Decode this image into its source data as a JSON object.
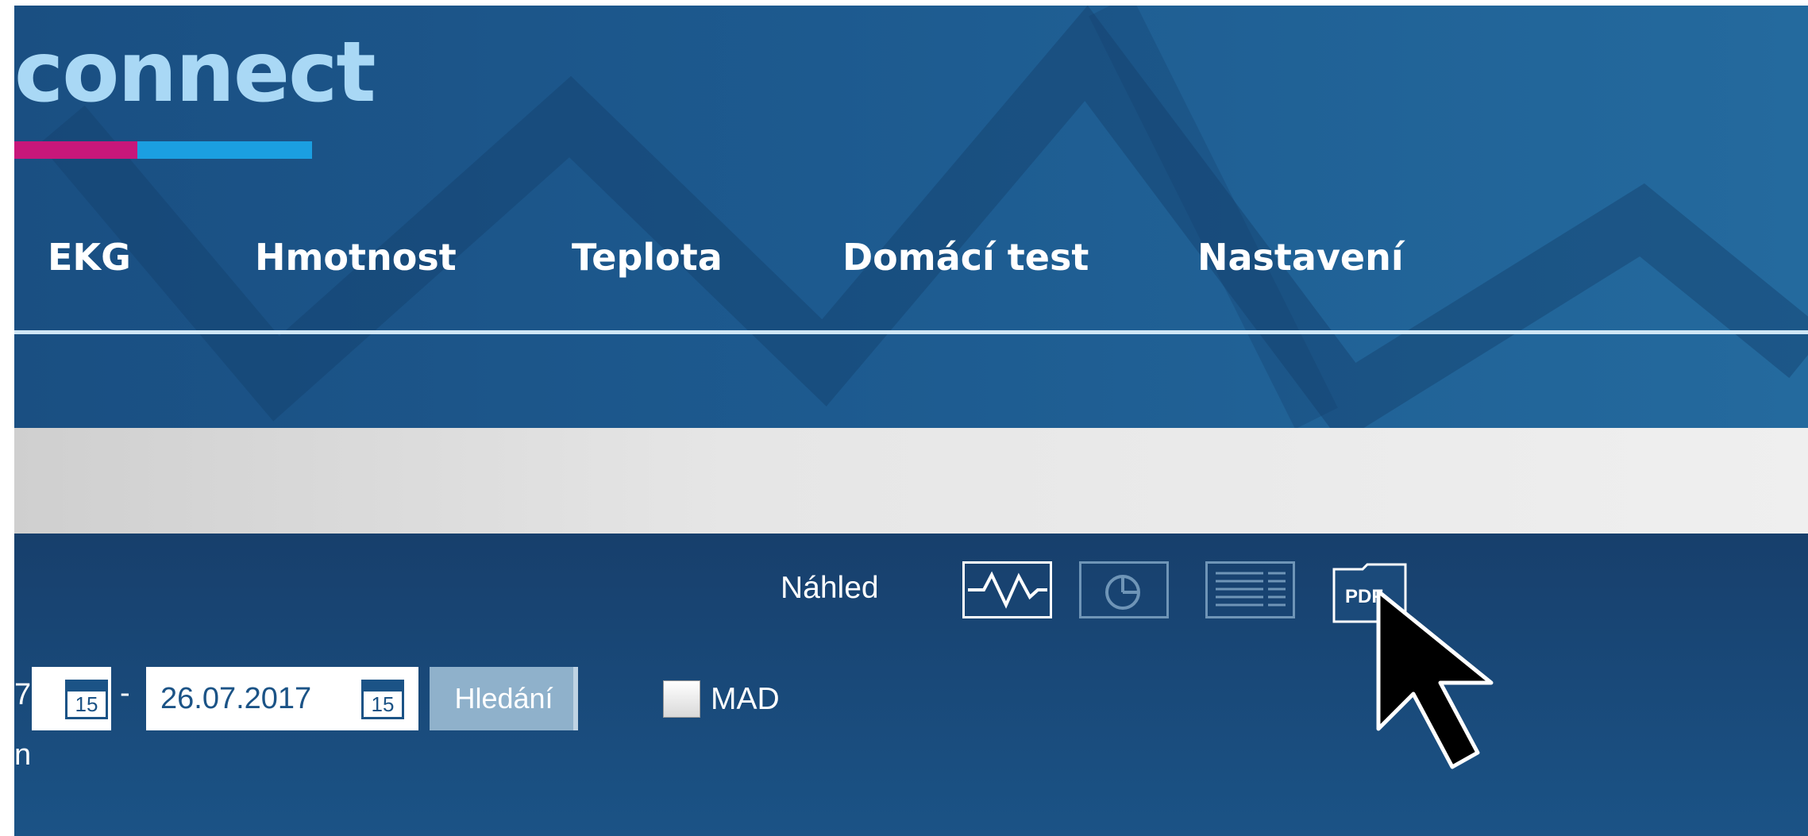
{
  "header": {
    "logo_text": "connect",
    "nav": [
      "EKG",
      "Hmotnost",
      "Teplota",
      "Domácí test",
      "Nastavení"
    ]
  },
  "toolbar": {
    "preview_label": "Náhled",
    "view_buttons": [
      "chart-view-icon",
      "pie-chart-view-icon",
      "table-view-icon",
      "pdf-icon"
    ],
    "pdf_text": "PDF",
    "date_from_partial": "7",
    "date_separator": "-",
    "date_to": "26.07.2017",
    "calendar_day": "15",
    "search_label": "Hledání",
    "mad_label": "MAD",
    "partial_line": "n"
  },
  "colors": {
    "header_blue": "#1d5a8f",
    "logo_text": "#a9d8f5",
    "logo_pink": "#c8177a",
    "logo_blue": "#1b9fe1",
    "search_button": "#8fb1cb"
  }
}
